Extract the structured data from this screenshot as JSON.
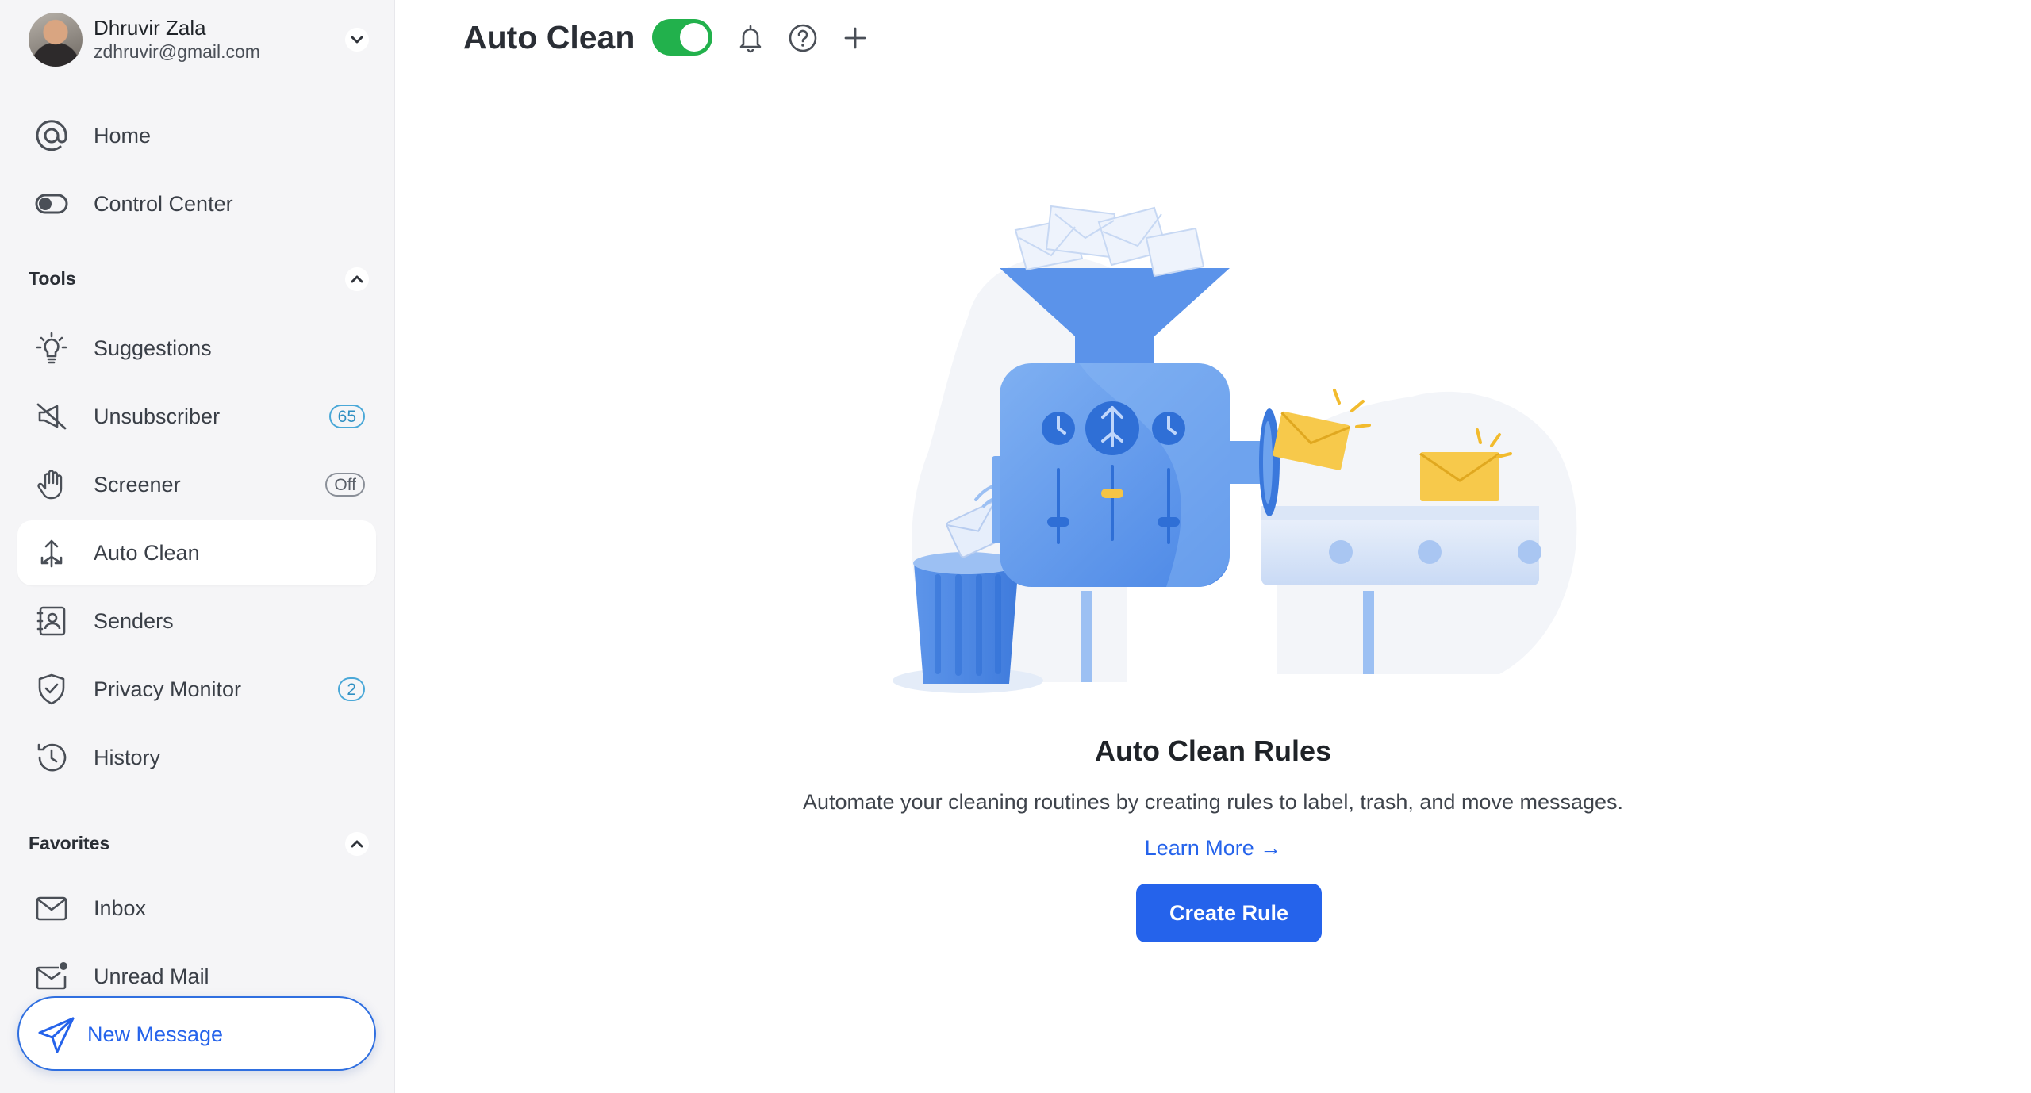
{
  "profile": {
    "name": "Dhruvir Zala",
    "email": "zdhruvir@gmail.com"
  },
  "nav": {
    "home": "Home",
    "control_center": "Control Center"
  },
  "tools": {
    "title": "Tools",
    "items": [
      {
        "label": "Suggestions",
        "icon": "lightbulb-icon"
      },
      {
        "label": "Unsubscriber",
        "icon": "muted-megaphone-icon",
        "badge": "65"
      },
      {
        "label": "Screener",
        "icon": "hand-icon",
        "badge": "Off"
      },
      {
        "label": "Auto Clean",
        "icon": "auto-clean-arrows-icon",
        "active": true
      },
      {
        "label": "Senders",
        "icon": "contact-card-icon"
      },
      {
        "label": "Privacy Monitor",
        "icon": "shield-check-icon",
        "badge": "2"
      },
      {
        "label": "History",
        "icon": "clock-history-icon"
      }
    ]
  },
  "favorites": {
    "title": "Favorites",
    "items": [
      {
        "label": "Inbox",
        "icon": "envelope-icon"
      },
      {
        "label": "Unread Mail",
        "icon": "envelope-unread-icon"
      }
    ]
  },
  "new_message": {
    "label": "New Message"
  },
  "header": {
    "title": "Auto Clean",
    "toggle_on": true
  },
  "empty_state": {
    "title": "Auto Clean Rules",
    "description": "Automate your cleaning routines by creating rules to label, trash, and move messages.",
    "learn_more": "Learn More →",
    "button": "Create Rule"
  },
  "colors": {
    "accent": "#2563eb",
    "toggle_on": "#22b14c",
    "sidebar_bg": "#f5f5f7",
    "badge_blue": "#2f8fc2"
  }
}
